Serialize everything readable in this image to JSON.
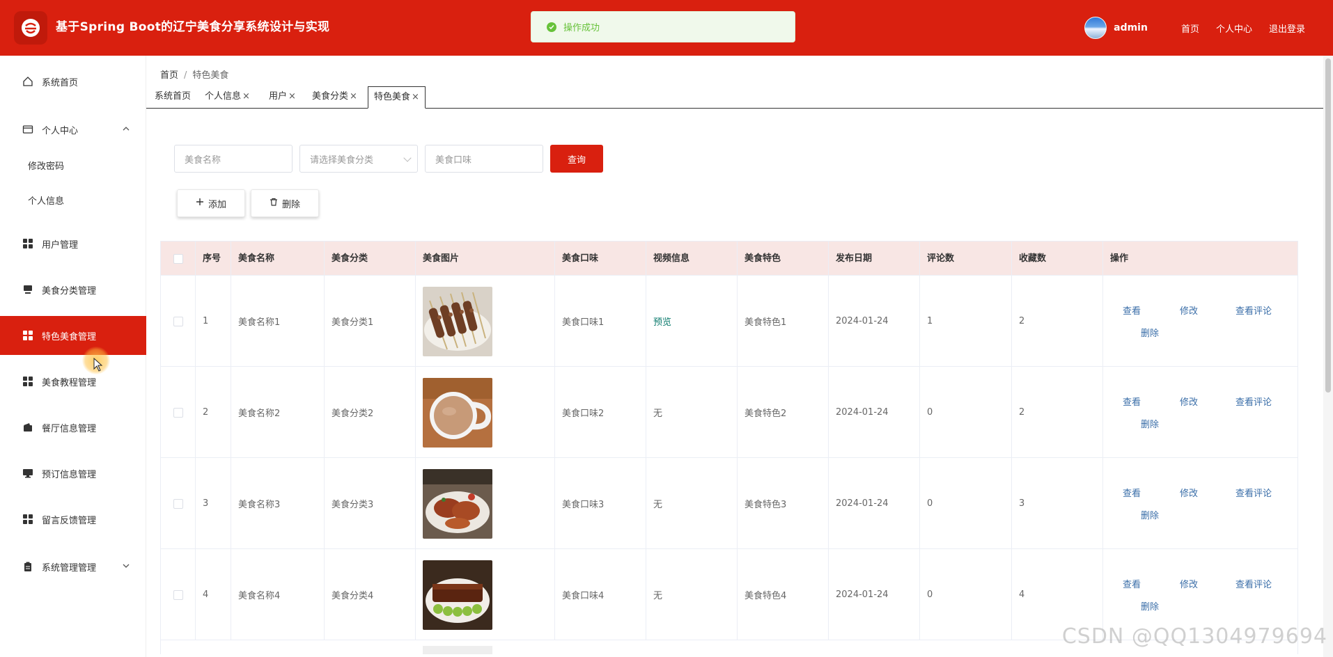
{
  "header": {
    "app_title": "基于Spring Boot的辽宁美食分享系统设计与实现",
    "toast": "操作成功",
    "user_name": "admin",
    "links": [
      "首页",
      "个人中心",
      "退出登录"
    ]
  },
  "sidebar": {
    "home": "系统首页",
    "personal_center": "个人中心",
    "change_password": "修改密码",
    "personal_info": "个人信息",
    "user_mgmt": "用户管理",
    "category_mgmt": "美食分类管理",
    "special_food_mgmt": "特色美食管理",
    "tutorial_mgmt": "美食教程管理",
    "restaurant_mgmt": "餐厅信息管理",
    "booking_mgmt": "预订信息管理",
    "feedback_mgmt": "留言反馈管理",
    "system_mgmt": "系统管理管理"
  },
  "breadcrumb": {
    "home": "首页",
    "sep": "/",
    "current": "特色美食"
  },
  "tabs": [
    {
      "label": "系统首页",
      "closable": false
    },
    {
      "label": "个人信息",
      "closable": true
    },
    {
      "label": "用户",
      "closable": true
    },
    {
      "label": "美食分类",
      "closable": true
    },
    {
      "label": "特色美食",
      "closable": true
    }
  ],
  "tab_close": "×",
  "search": {
    "name_placeholder": "美食名称",
    "category_placeholder": "请选择美食分类",
    "taste_placeholder": "美食口味",
    "query_label": "查询"
  },
  "toolbar": {
    "add_label": "添加",
    "delete_label": "删除"
  },
  "table": {
    "headers": [
      "序号",
      "美食名称",
      "美食分类",
      "美食图片",
      "美食口味",
      "视频信息",
      "美食特色",
      "发布日期",
      "评论数",
      "收藏数",
      "操作"
    ],
    "ops": {
      "view": "查看",
      "edit": "修改",
      "view_comments": "查看评论",
      "delete": "删除"
    },
    "rows": [
      {
        "no": "1",
        "name": "美食名称1",
        "category": "美食分类1",
        "taste": "美食口味1",
        "video": "预览",
        "feature": "美食特色1",
        "date": "2024-01-24",
        "comments": "1",
        "favorites": "2"
      },
      {
        "no": "2",
        "name": "美食名称2",
        "category": "美食分类2",
        "taste": "美食口味2",
        "video": "无",
        "feature": "美食特色2",
        "date": "2024-01-24",
        "comments": "0",
        "favorites": "2"
      },
      {
        "no": "3",
        "name": "美食名称3",
        "category": "美食分类3",
        "taste": "美食口味3",
        "video": "无",
        "feature": "美食特色3",
        "date": "2024-01-24",
        "comments": "0",
        "favorites": "3"
      },
      {
        "no": "4",
        "name": "美食名称4",
        "category": "美食分类4",
        "taste": "美食口味4",
        "video": "无",
        "feature": "美食特色4",
        "date": "2024-01-24",
        "comments": "0",
        "favorites": "4"
      }
    ]
  },
  "watermark": "CSDN @QQ1304979694",
  "colors": {
    "primary": "#d9200f",
    "table_header": "#f8e6e4",
    "link": "#3a6ea8",
    "success": "#67c23a"
  }
}
